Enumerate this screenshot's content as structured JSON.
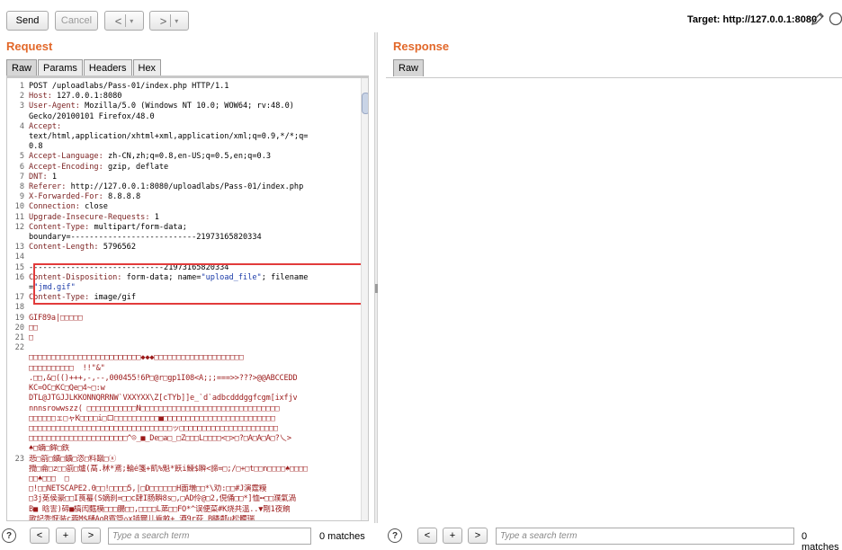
{
  "toolbar": {
    "send_label": "Send",
    "cancel_label": "Cancel",
    "back_symbol": "<",
    "forward_symbol": ">",
    "dropdown_symbol": "▾",
    "target_text": "Target: http://127.0.0.1:8080"
  },
  "request": {
    "title": "Request",
    "tabs": [
      "Raw",
      "Params",
      "Headers",
      "Hex"
    ],
    "lines": [
      {
        "n": "1",
        "k": "",
        "v": "POST /uploadlabs/Pass-01/index.php HTTP/1.1"
      },
      {
        "n": "2",
        "k": "Host:",
        "v": " 127.0.0.1:8080"
      },
      {
        "n": "3",
        "k": "User-Agent:",
        "v": " Mozilla/5.0 (Windows NT 10.0; WOW64; rv:48.0)"
      },
      {
        "n": "",
        "k": "",
        "v": "Gecko/20100101 Firefox/48.0"
      },
      {
        "n": "4",
        "k": "Accept:",
        "v": ""
      },
      {
        "n": "",
        "k": "",
        "v": "text/html,application/xhtml+xml,application/xml;q=0.9,*/*;q="
      },
      {
        "n": "",
        "k": "",
        "v": "0.8"
      },
      {
        "n": "5",
        "k": "Accept-Language:",
        "v": " zh-CN,zh;q=0.8,en-US;q=0.5,en;q=0.3"
      },
      {
        "n": "6",
        "k": "Accept-Encoding:",
        "v": " gzip, deflate"
      },
      {
        "n": "7",
        "k": "DNT:",
        "v": " 1"
      },
      {
        "n": "8",
        "k": "Referer:",
        "v": " http://127.0.0.1:8080/uploadlabs/Pass-01/index.php"
      },
      {
        "n": "9",
        "k": "X-Forwarded-For:",
        "v": " 8.8.8.8"
      },
      {
        "n": "10",
        "k": "Connection:",
        "v": " close"
      },
      {
        "n": "11",
        "k": "Upgrade-Insecure-Requests:",
        "v": " 1"
      },
      {
        "n": "12",
        "k": "Content-Type:",
        "v": " multipart/form-data;"
      },
      {
        "n": "",
        "k": "",
        "v": "boundary=---------------------------21973165820334"
      },
      {
        "n": "13",
        "k": "Content-Length:",
        "v": " 5796562"
      },
      {
        "n": "14",
        "k": "",
        "v": ""
      },
      {
        "n": "15",
        "k": "",
        "v": "-----------------------------21973165820334"
      },
      {
        "n": "16",
        "k": "Content-Disposition:",
        "v": " form-data; name=\"upload_file\"; filename"
      },
      {
        "n": "",
        "k": "",
        "v": "=\"jmd.gif\""
      },
      {
        "n": "17",
        "k": "Content-Type:",
        "v": " image/gif"
      },
      {
        "n": "18",
        "k": "",
        "v": ""
      },
      {
        "n": "19",
        "k": "",
        "v": "GIF89a|□□□□□",
        "bin": true
      },
      {
        "n": "20",
        "k": "",
        "v": "□□",
        "bin": true
      },
      {
        "n": "21",
        "k": "",
        "v": "□",
        "bin": true
      },
      {
        "n": "22",
        "k": "",
        "v": ""
      },
      {
        "n": "",
        "k": "",
        "v": "□□□□□□□□□□□□□□□□□□□□□□□□□◆◆◆□□□□□□□□□□□□□□□□□□□□",
        "bin": true
      },
      {
        "n": "",
        "k": "",
        "v": "□□□□□□□□□□  !!\"&\"",
        "bin": true
      },
      {
        "n": "",
        "k": "",
        "v": ".□□,&□(()+++,-,--,000455!6P□@r□gp1I08<A;;;===>>???>@@ABCCEDD",
        "bin": true
      },
      {
        "n": "",
        "k": "",
        "v": "KC=OC□KC□Qe□4~□:w",
        "bin": true
      },
      {
        "n": "",
        "k": "",
        "v": "DTL@JTGJJLKKONNQRRNW`VXXYXX\\Z[cTYb]]e_`d`adbcdddggfcgm[ixfjv",
        "bin": true
      },
      {
        "n": "",
        "k": "",
        "v": "nnnsrowwszz( □□□□□□□□□□□N□□□□□□□□□□□□□□□□□□□□□□□□□□□□□□□",
        "bin": true
      },
      {
        "n": "",
        "k": "",
        "v": "□□□□□□ェ□ャK□□□□i□ロ□□□□□□□□□□■□□□□□□□□□□□□□□□□□□□□□□□□□",
        "bin": true
      },
      {
        "n": "",
        "k": "",
        "v": "□□□□□□□□□□□□□□□□□□□□□□□□□□□□□□□□ッ□□□□□□□□□□□□□□□□□□□□□□",
        "bin": true
      },
      {
        "n": "",
        "k": "",
        "v": "□□□□□□□□□□□□□□□□□□□□□□^☺_■_De□a□_□Z□□□L□□□□<□>□?□A□A□A□?乀>",
        "bin": true
      },
      {
        "n": "",
        "k": "",
        "v": "♠□蝻□鉾□鉃",
        "bin": true
      },
      {
        "n": "23",
        "k": "",
        "v": "悲□箚□鑛□鑛□恣□料蹴□ⓧ",
        "bin": true
      },
      {
        "n": "",
        "k": "",
        "v": "攪□侖□z□□箚□爐(萵.秫*鳶;輪é箋+飢%魁*飫i鰊$瞬<諦=□;/□+□t□□n□□□□♠□□□□",
        "bin": true
      },
      {
        "n": "",
        "k": "",
        "v": "□□♠□□□  □",
        "bin": true
      },
      {
        "n": "",
        "k": "",
        "v": "□!□□NETSCAPE2.0□□!□□□□5,|□D□□□□□□H面増□□*\\劝:□□#J演霆糢",
        "bin": true
      },
      {
        "n": "",
        "k": "",
        "v": "□3j莬侯豪□□I莨蟇(S嫡刹=□□c肆I肠瞬8s□,□AD伶@□2,俔俑□□*]恤╍□□濮氣渦",
        "bin": true
      },
      {
        "n": "",
        "k": "",
        "v": "B■ 晗霅)碲■槁闶薽模□□□腸□□,□□□□L苐□□FO*^误便菜#K烧共溫..▼剛1夜餉",
        "bin": true
      },
      {
        "n": "",
        "k": "",
        "v": "歟記秃恹装c蓉M$樋AoR賓箜◇x插爾儿肯畝+ 酒9r荻 B疄鄰u松髑瑞",
        "bin": true
      }
    ]
  },
  "response": {
    "title": "Response",
    "tabs": [
      "Raw"
    ]
  },
  "search": {
    "help_symbol": "?",
    "prev_symbol": "<",
    "add_symbol": "+",
    "next_symbol": ">",
    "placeholder": "Type a search term",
    "matches_text": "0 matches"
  }
}
